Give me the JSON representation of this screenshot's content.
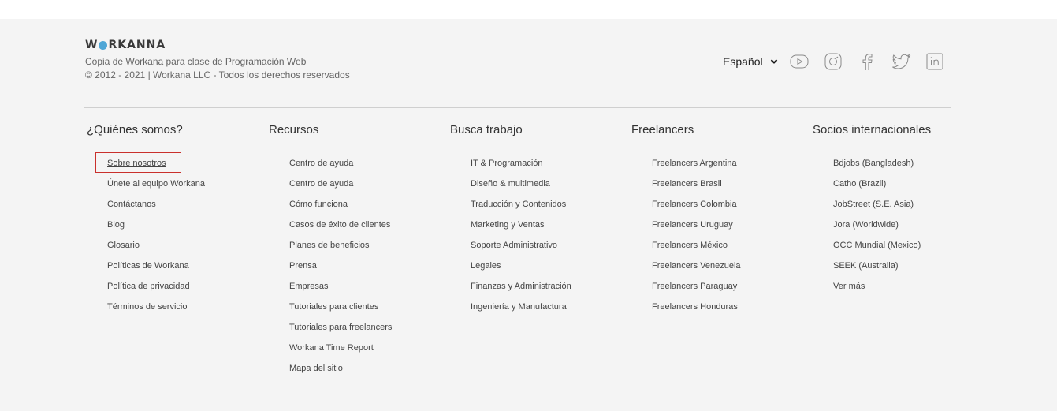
{
  "brand": {
    "logo_text_pre": "W",
    "logo_text_post": "RKANNA",
    "tagline1": "Copia de Workana para clase de Programación Web",
    "tagline2": "© 2012 - 2021 | Workana LLC - Todos los derechos reservados"
  },
  "language": {
    "selected": "Español"
  },
  "social": [
    "youtube-icon",
    "instagram-icon",
    "facebook-icon",
    "twitter-icon",
    "linkedin-icon"
  ],
  "columns": [
    {
      "title": "¿Quiénes somos?",
      "items": [
        "Sobre nosotros",
        "Únete al equipo Workana",
        "Contáctanos",
        "Blog",
        "Glosario",
        "Políticas de Workana",
        "Política de privacidad",
        "Términos de servicio"
      ]
    },
    {
      "title": "Recursos",
      "items": [
        "Centro de ayuda",
        "Centro de ayuda",
        "Cómo funciona",
        "Casos de éxito de clientes",
        "Planes de beneficios",
        "Prensa",
        "Empresas",
        "Tutoriales para clientes",
        "Tutoriales para freelancers",
        "Workana Time Report",
        "Mapa del sitio"
      ]
    },
    {
      "title": "Busca trabajo",
      "items": [
        "IT & Programación",
        "Diseño & multimedia",
        "Traducción y Contenidos",
        "Marketing y Ventas",
        "Soporte Administrativo",
        "Legales",
        "Finanzas y Administración",
        "Ingeniería y Manufactura"
      ]
    },
    {
      "title": "Freelancers",
      "items": [
        "Freelancers Argentina",
        "Freelancers Brasil",
        "Freelancers Colombia",
        "Freelancers Uruguay",
        "Freelancers México",
        "Freelancers Venezuela",
        "Freelancers Paraguay",
        "Freelancers Honduras"
      ]
    },
    {
      "title": "Socios internacionales",
      "items": [
        "Bdjobs (Bangladesh)",
        "Catho (Brazil)",
        "JobStreet (S.E. Asia)",
        "Jora (Worldwide)",
        "OCC Mundial (Mexico)",
        "SEEK (Australia)",
        "Ver más"
      ]
    }
  ],
  "colors": {
    "footer_bg": "#f4f4f4",
    "logo_dot": "#4fa6d6",
    "highlight_border": "#c9302c"
  }
}
